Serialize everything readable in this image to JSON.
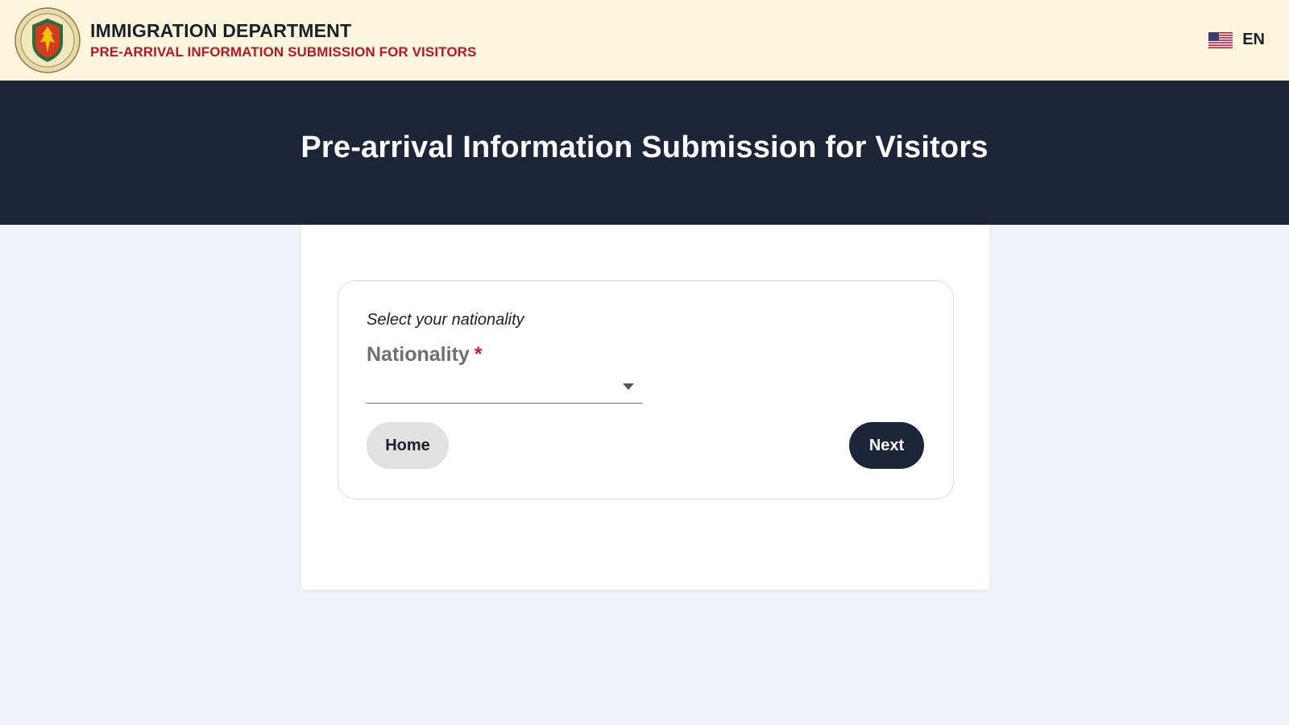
{
  "header": {
    "title": "IMMIGRATION DEPARTMENT",
    "subtitle": "PRE-ARRIVAL INFORMATION SUBMISSION FOR VISITORS",
    "logo_icon": "immigration-emblem-icon",
    "language": {
      "label": "EN",
      "flag_icon": "us-flag-icon"
    }
  },
  "hero": {
    "title": "Pre-arrival Information Submission for Visitors"
  },
  "form": {
    "hint": "Select your nationality",
    "nationality": {
      "label": "Nationality",
      "required_mark": "*",
      "value": ""
    },
    "home_button": "Home",
    "next_button": "Next"
  },
  "colors": {
    "topbar_bg": "#fdf6dc",
    "hero_bg": "#1d2639",
    "accent_red": "#b3182a",
    "page_bg": "#eef1f6"
  }
}
